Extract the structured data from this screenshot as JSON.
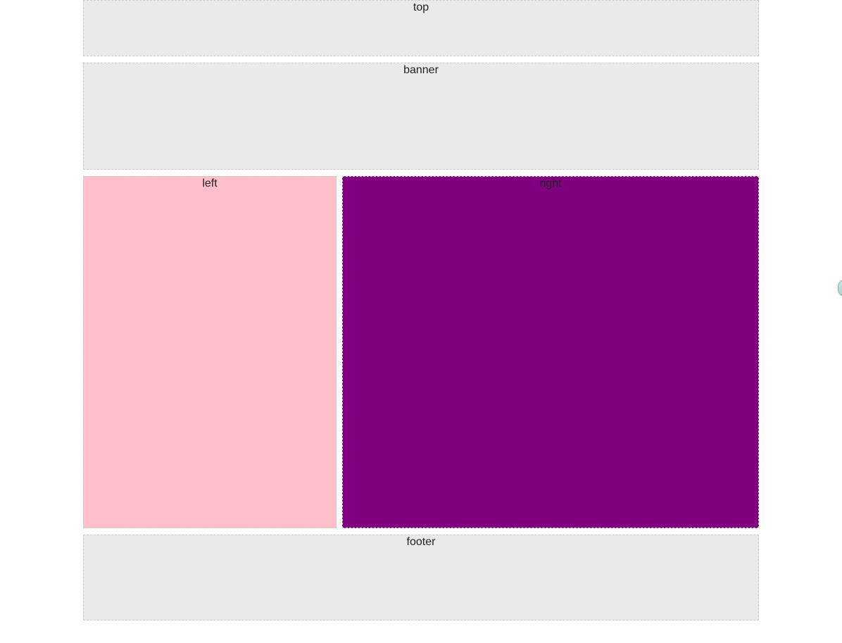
{
  "layout": {
    "top": {
      "label": "top"
    },
    "banner": {
      "label": "banner"
    },
    "left": {
      "label": "left",
      "bg_color": "#ffc0cb"
    },
    "right": {
      "label": "right",
      "bg_color": "#800080"
    },
    "footer": {
      "label": "footer"
    }
  }
}
